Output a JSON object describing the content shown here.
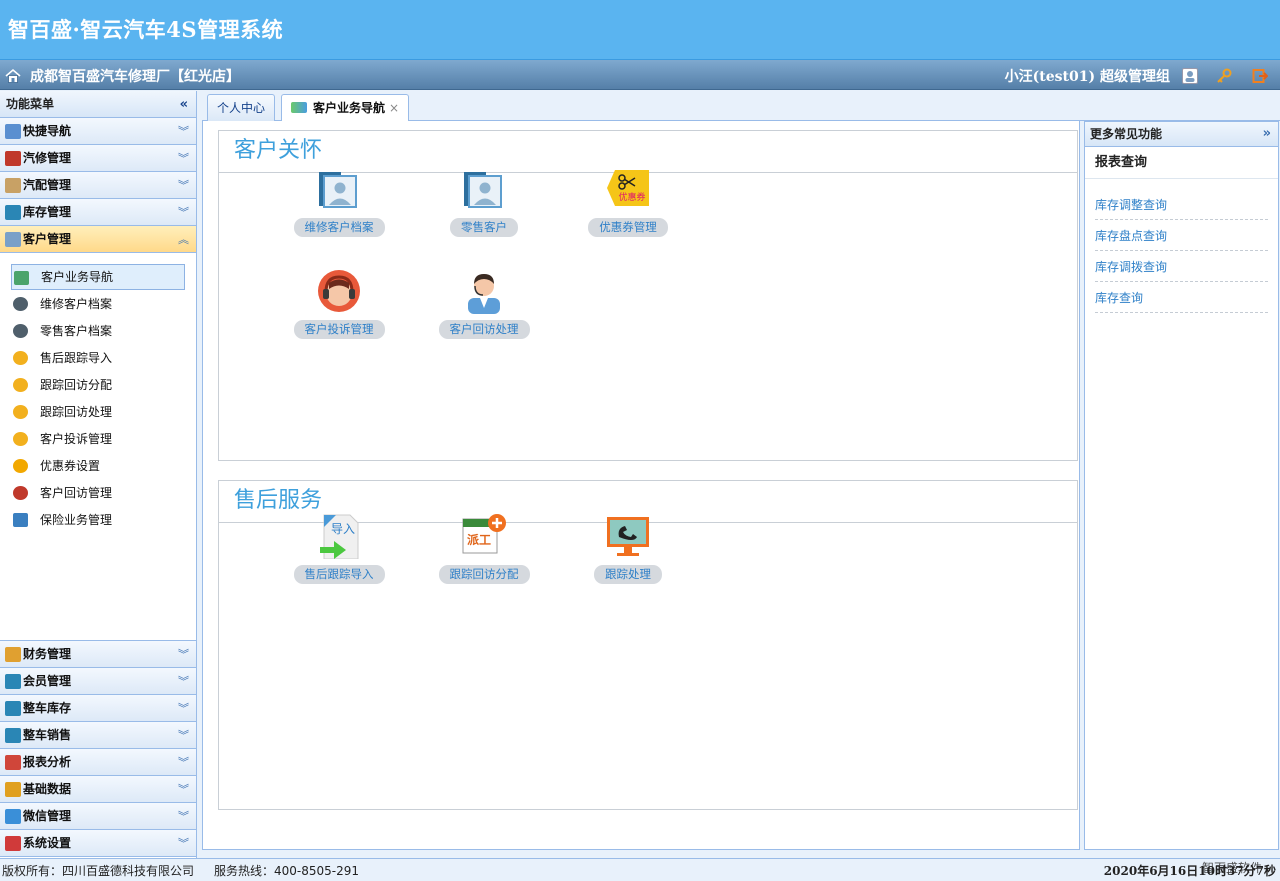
{
  "header": {
    "app_title": "智百盛·智云汽车4S管理系统",
    "shop_name": "成都智百盛汽车修理厂【红光店】",
    "user_info": "小汪(test01) 超级管理组"
  },
  "left_menu": {
    "title": "功能菜单",
    "groups_top": [
      {
        "label": "快捷导航",
        "icon": "home-icon",
        "color": "#5a8fd0"
      },
      {
        "label": "汽修管理",
        "icon": "tools-icon",
        "color": "#c0392b"
      },
      {
        "label": "汽配管理",
        "icon": "parts-icon",
        "color": "#c8a165"
      },
      {
        "label": "库存管理",
        "icon": "warehouse-icon",
        "color": "#2a86b5"
      },
      {
        "label": "客户管理",
        "icon": "customer-icon",
        "color": "#7aa0c8"
      }
    ],
    "sub_items": [
      {
        "label": "客户业务导航",
        "icon": "map-icon",
        "color": "#4ba46b"
      },
      {
        "label": "维修客户档案",
        "icon": "people-icon",
        "color": "#4f5f6b"
      },
      {
        "label": "零售客户档案",
        "icon": "people-icon",
        "color": "#4f5f6b"
      },
      {
        "label": "售后跟踪导入",
        "icon": "star-icon",
        "color": "#f2b01e"
      },
      {
        "label": "跟踪回访分配",
        "icon": "star-icon",
        "color": "#f2b01e"
      },
      {
        "label": "跟踪回访处理",
        "icon": "star-icon",
        "color": "#f2b01e"
      },
      {
        "label": "客户投诉管理",
        "icon": "star-icon",
        "color": "#f2b01e"
      },
      {
        "label": "优惠券设置",
        "icon": "star-icon",
        "color": "#f2a800"
      },
      {
        "label": "客户回访管理",
        "icon": "heart-icon",
        "color": "#c0392b"
      },
      {
        "label": "保险业务管理",
        "icon": "sliders-icon",
        "color": "#3a7fc0"
      }
    ],
    "groups_bottom": [
      {
        "label": "财务管理",
        "icon": "finance-icon",
        "color": "#e0a030"
      },
      {
        "label": "会员管理",
        "icon": "member-icon",
        "color": "#2a86b5"
      },
      {
        "label": "整车库存",
        "icon": "car-stock-icon",
        "color": "#2a86b5"
      },
      {
        "label": "整车销售",
        "icon": "car-sales-icon",
        "color": "#2a86b5"
      },
      {
        "label": "报表分析",
        "icon": "pie-chart-icon",
        "color": "#d0463a"
      },
      {
        "label": "基础数据",
        "icon": "database-icon",
        "color": "#e0a020"
      },
      {
        "label": "微信管理",
        "icon": "wechat-icon",
        "color": "#3a8fd8"
      },
      {
        "label": "系统设置",
        "icon": "settings-icon",
        "color": "#d03a3a"
      }
    ]
  },
  "tabs": [
    {
      "label": "个人中心"
    },
    {
      "label": "客户业务导航",
      "close": "×"
    }
  ],
  "panels": [
    {
      "title": "客户关怀",
      "tiles": [
        {
          "label": "维修客户档案",
          "icon": "folder-user-icon"
        },
        {
          "label": "零售客户",
          "icon": "folder-user-icon"
        },
        {
          "label": "优惠券管理",
          "icon": "coupon-icon"
        },
        {
          "label": "客户投诉管理",
          "icon": "headset-icon"
        },
        {
          "label": "客户回访处理",
          "icon": "agent-icon"
        }
      ]
    },
    {
      "title": "售后服务",
      "tiles": [
        {
          "label": "售后跟踪导入",
          "icon": "import-icon",
          "icon_text": "导入"
        },
        {
          "label": "跟踪回访分配",
          "icon": "dispatch-icon",
          "icon_text": "派工"
        },
        {
          "label": "跟踪处理",
          "icon": "phone-monitor-icon"
        }
      ]
    }
  ],
  "right_panel": {
    "title": "更多常见功能",
    "section": "报表查询",
    "links": [
      "库存调整查询",
      "库存盘点查询",
      "库存调拨查询",
      "库存查询"
    ]
  },
  "footer": {
    "copyright": "版权所有：四川百盛德科技有限公司",
    "hotline": "服务热线：400-8505-291",
    "clock": "2020年6月16日10时37分7秒",
    "watermark": "智百盛软件"
  }
}
